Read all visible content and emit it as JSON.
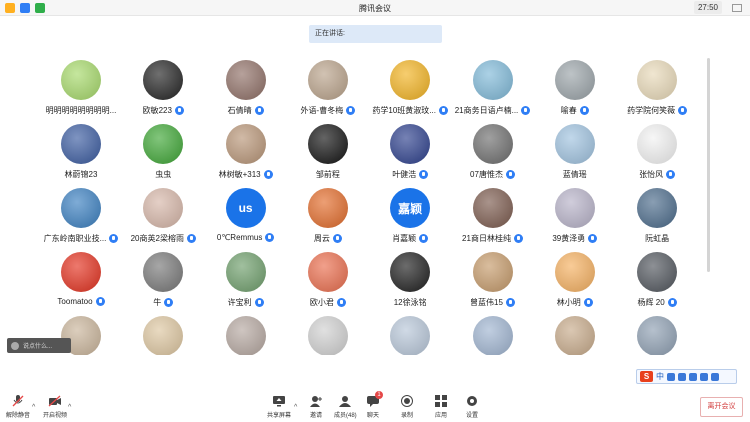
{
  "window": {
    "title": "腾讯会议",
    "time": "27:50"
  },
  "speaking_label": "正在讲话:",
  "colors": {
    "mic_active": "#2f7ef5",
    "leave": "#d23c3c",
    "banner": "#dde9f8"
  },
  "participants": [
    {
      "name": "明明明明明明明明...",
      "mic": false,
      "avatar": "frog-avatar",
      "bg": "#a6d96a"
    },
    {
      "name": "欧敏223",
      "mic": true,
      "avatar": "calligraphy-avatar",
      "bg": "#222222"
    },
    {
      "name": "石倩晴",
      "mic": true,
      "avatar": "photo-avatar",
      "bg": "#8f6f66"
    },
    {
      "name": "外语-曹冬梅",
      "mic": true,
      "avatar": "photo-avatar",
      "bg": "#b9a28a"
    },
    {
      "name": "药学10班黄淑玟...",
      "mic": true,
      "avatar": "bear-avatar",
      "bg": "#f2b322"
    },
    {
      "name": "21商务日语卢楠...",
      "mic": true,
      "avatar": "anime-avatar",
      "bg": "#7fb9d8"
    },
    {
      "name": "喻春",
      "mic": true,
      "avatar": "photo-avatar",
      "bg": "#9aa3a8"
    },
    {
      "name": "药学院何笑薇",
      "mic": true,
      "avatar": "anime-avatar",
      "bg": "#e8d9b8"
    },
    {
      "name": "林蔚锦23",
      "mic": false,
      "avatar": "anime-avatar",
      "bg": "#3a5ba0"
    },
    {
      "name": "虫虫",
      "mic": false,
      "avatar": "bug-avatar",
      "bg": "#3ea635"
    },
    {
      "name": "林树敏+313",
      "mic": true,
      "avatar": "anime-avatar",
      "bg": "#b89577"
    },
    {
      "name": "邹前程",
      "mic": false,
      "avatar": "dark-avatar",
      "bg": "#111111"
    },
    {
      "name": "叶健浩",
      "mic": true,
      "avatar": "space-avatar",
      "bg": "#2c3f8c"
    },
    {
      "name": "07唐惟杰",
      "mic": true,
      "avatar": "photo-avatar",
      "bg": "#6d6d6d"
    },
    {
      "name": "蓝倩瑶",
      "mic": false,
      "avatar": "photo-avatar",
      "bg": "#9fc2df"
    },
    {
      "name": "张怡风",
      "mic": true,
      "avatar": "sketch-avatar",
      "bg": "#f2f2f2"
    },
    {
      "name": "广东岭南职业技...",
      "mic": true,
      "avatar": "sport-avatar",
      "bg": "#3a7fc0"
    },
    {
      "name": "20商英2梁榕雨",
      "mic": true,
      "avatar": "photo-avatar",
      "bg": "#d6b6a8"
    },
    {
      "name": "0℃Remmus",
      "mic": true,
      "avatar": "text-avatar",
      "text": "us",
      "bg": "#1a73e8"
    },
    {
      "name": "周云",
      "mic": true,
      "avatar": "dino-avatar",
      "bg": "#e26b2a"
    },
    {
      "name": "肖嘉颖",
      "mic": true,
      "avatar": "text-avatar",
      "text": "嘉颖",
      "bg": "#1a73e8"
    },
    {
      "name": "21商日林桂纯",
      "mic": true,
      "avatar": "photo-avatar",
      "bg": "#7b5a4d"
    },
    {
      "name": "39黄泽勇",
      "mic": true,
      "avatar": "photo-avatar",
      "bg": "#b7b2c8"
    },
    {
      "name": "阮虹晶",
      "mic": false,
      "avatar": "photo-avatar",
      "bg": "#4a6a8a"
    },
    {
      "name": "Toomatoo",
      "mic": true,
      "avatar": "tomato-avatar",
      "bg": "#e3311f"
    },
    {
      "name": "牛",
      "mic": true,
      "avatar": "grey-avatar",
      "bg": "#777777"
    },
    {
      "name": "许宝利",
      "mic": true,
      "avatar": "photo-avatar",
      "bg": "#6e9e6b"
    },
    {
      "name": "欧小君",
      "mic": true,
      "avatar": "cartoon-avatar",
      "bg": "#ea6d4d"
    },
    {
      "name": "12徐泳铭",
      "mic": false,
      "avatar": "dark-avatar",
      "bg": "#1d1d1d"
    },
    {
      "name": "曾蓝伟15",
      "mic": true,
      "avatar": "dog-avatar",
      "bg": "#c59a6a"
    },
    {
      "name": "林小明",
      "mic": true,
      "avatar": "dog-avatar",
      "bg": "#f5b060"
    },
    {
      "name": "杨辉 20",
      "mic": true,
      "avatar": "photo-avatar",
      "bg": "#50555c"
    },
    {
      "name": "",
      "mic": false,
      "avatar": "photo-avatar",
      "bg": "#c9b49a"
    },
    {
      "name": "",
      "mic": false,
      "avatar": "photo-avatar",
      "bg": "#ddc6a0"
    },
    {
      "name": "",
      "mic": false,
      "avatar": "photo-avatar",
      "bg": "#b5a7a0"
    },
    {
      "name": "",
      "mic": false,
      "avatar": "photo-avatar",
      "bg": "#d0d0d0"
    },
    {
      "name": "",
      "mic": false,
      "avatar": "photo-avatar",
      "bg": "#b7c6d8"
    },
    {
      "name": "",
      "mic": false,
      "avatar": "photo-avatar",
      "bg": "#9fb4d0"
    },
    {
      "name": "",
      "mic": false,
      "avatar": "photo-avatar",
      "bg": "#c7aa8a"
    },
    {
      "name": "",
      "mic": false,
      "avatar": "photo-avatar",
      "bg": "#8e9fb2"
    }
  ],
  "chat_preview": "说点什么...",
  "ime": {
    "label": "中"
  },
  "toolbar": {
    "mute": "解除静音",
    "video": "开启视频",
    "share": "共享屏幕",
    "invite": "邀请",
    "members": "成员(48)",
    "chat": "聊天",
    "chat_badge": "1",
    "record": "录制",
    "apps": "应用",
    "settings": "设置",
    "leave": "离开会议"
  }
}
